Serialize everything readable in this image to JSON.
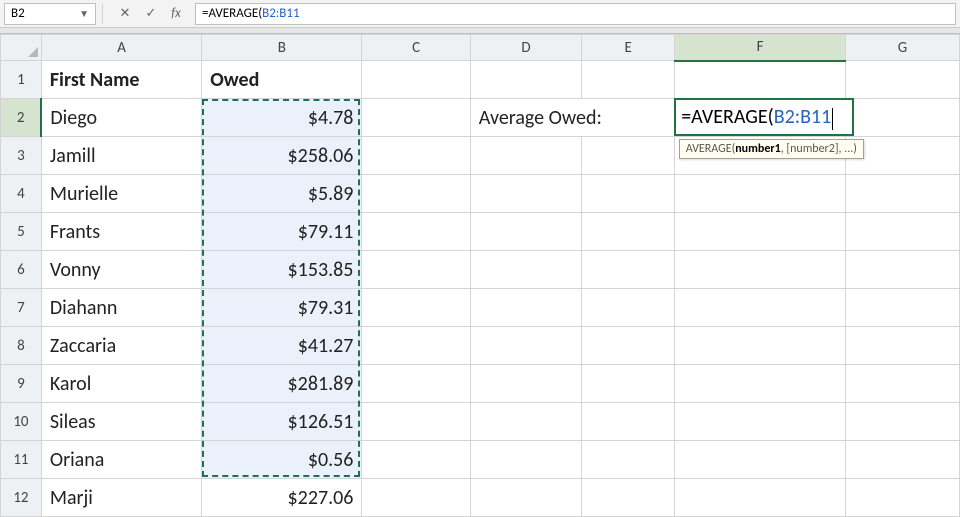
{
  "namebox": {
    "value": "B2"
  },
  "formula_bar": {
    "fn": "=AVERAGE(",
    "range": "B2:B11",
    "close": ""
  },
  "columns": [
    "A",
    "B",
    "C",
    "D",
    "E",
    "F",
    "G"
  ],
  "row_numbers": [
    1,
    2,
    3,
    4,
    5,
    6,
    7,
    8,
    9,
    10,
    11,
    12
  ],
  "headers": {
    "A": "First Name",
    "B": "Owed"
  },
  "names": [
    "Diego",
    "Jamill",
    "Murielle",
    "Frants",
    "Vonny",
    "Diahann",
    "Zaccaria",
    "Karol",
    "Sileas",
    "Oriana",
    "Marji"
  ],
  "owed": [
    "$4.78",
    "$258.06",
    "$5.89",
    "$79.11",
    "$153.85",
    "$79.31",
    "$41.27",
    "$281.89",
    "$126.51",
    "$0.56",
    "$227.06"
  ],
  "label_D2E2": "Average Owed:",
  "edit_cell": {
    "fn": "=AVERAGE(",
    "range": "B2:B11",
    "close": ""
  },
  "tooltip": {
    "fn": "AVERAGE",
    "args1": "number1",
    "args2": ", [number2], ...)"
  },
  "active_col": "F",
  "active_row": 2,
  "chart_data": {
    "type": "table",
    "columns": [
      "First Name",
      "Owed"
    ],
    "rows": [
      [
        "Diego",
        4.78
      ],
      [
        "Jamill",
        258.06
      ],
      [
        "Murielle",
        5.89
      ],
      [
        "Frants",
        79.11
      ],
      [
        "Vonny",
        153.85
      ],
      [
        "Diahann",
        79.31
      ],
      [
        "Zaccaria",
        41.27
      ],
      [
        "Karol",
        281.89
      ],
      [
        "Sileas",
        126.51
      ],
      [
        "Oriana",
        0.56
      ],
      [
        "Marji",
        227.06
      ]
    ]
  }
}
